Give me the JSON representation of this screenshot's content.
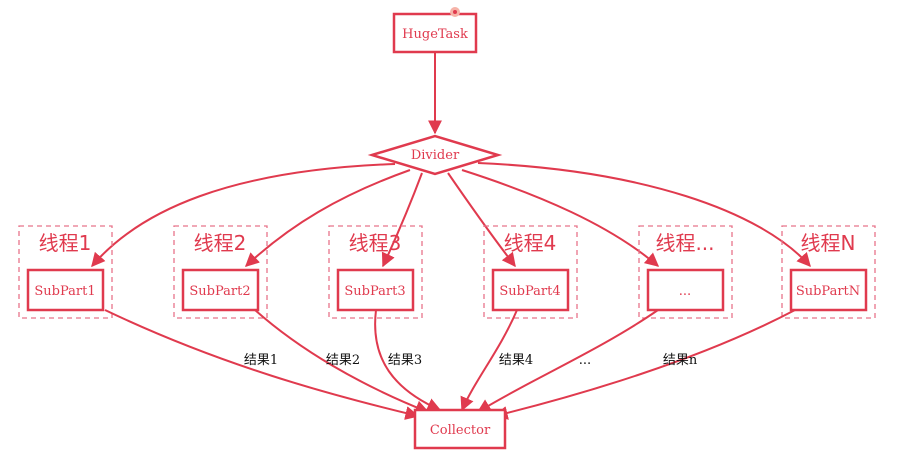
{
  "colors": {
    "accent": "#e03a4e",
    "dashed": "#e8748a",
    "text_label": "#111111"
  },
  "nodes": {
    "huge_task": "HugeTask",
    "divider": "Divider",
    "collector": "Collector"
  },
  "threads": [
    {
      "label": "线程1",
      "subpart": "SubPart1",
      "result": "结果1"
    },
    {
      "label": "线程2",
      "subpart": "SubPart2",
      "result": "结果2"
    },
    {
      "label": "线程3",
      "subpart": "SubPart3",
      "result": "结果3"
    },
    {
      "label": "线程4",
      "subpart": "SubPart4",
      "result": "结果4"
    },
    {
      "label": "线程...",
      "subpart": "...",
      "result": "..."
    },
    {
      "label": "线程N",
      "subpart": "SubPartN",
      "result": "结果n"
    }
  ]
}
